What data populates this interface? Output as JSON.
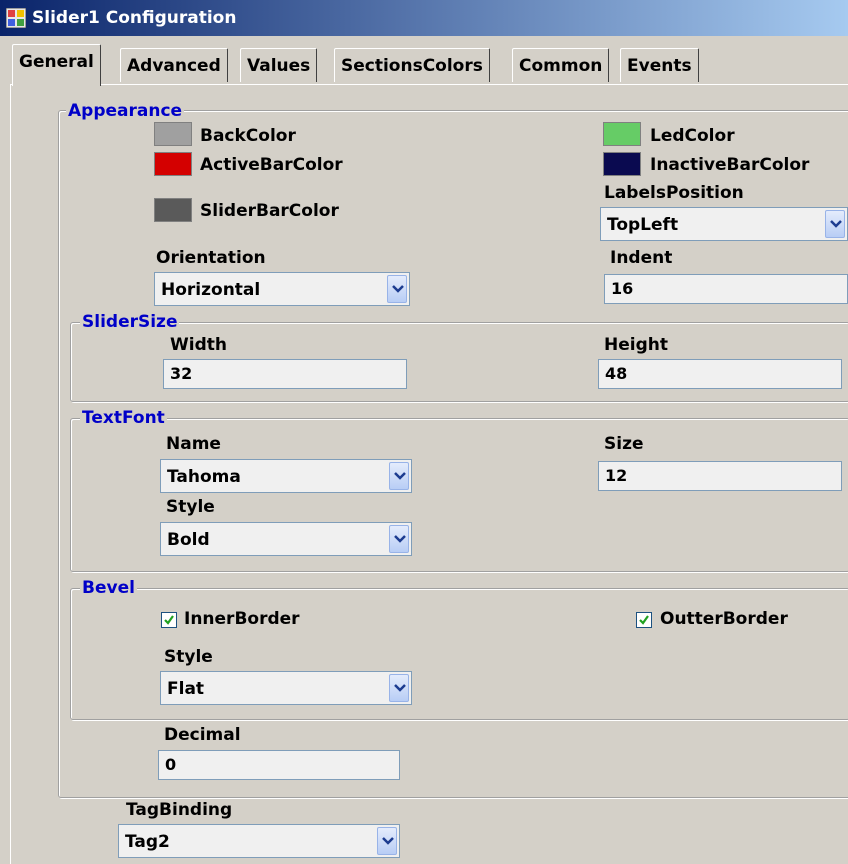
{
  "window": {
    "title": "Slider1 Configuration"
  },
  "tabs": [
    "General",
    "Advanced",
    "Values",
    "SectionsColors",
    "Common",
    "Events"
  ],
  "appearance": {
    "title": "Appearance",
    "back_color": {
      "label": "BackColor",
      "color": "#a0a0a0"
    },
    "active_bar_color": {
      "label": "ActiveBarColor",
      "color": "#d40000"
    },
    "slider_bar_color": {
      "label": "SliderBarColor",
      "color": "#5a5a5a"
    },
    "led_color": {
      "label": "LedColor",
      "color": "#66cc66"
    },
    "inactive_bar_color": {
      "label": "InactiveBarColor",
      "color": "#0a0a50"
    },
    "labels_position": {
      "label": "LabelsPosition",
      "value": "TopLeft"
    },
    "orientation": {
      "label": "Orientation",
      "value": "Horizontal"
    },
    "indent": {
      "label": "Indent",
      "value": "16"
    }
  },
  "slider_size": {
    "title": "SliderSize",
    "width": {
      "label": "Width",
      "value": "32"
    },
    "height": {
      "label": "Height",
      "value": "48"
    }
  },
  "text_font": {
    "title": "TextFont",
    "name": {
      "label": "Name",
      "value": "Tahoma"
    },
    "size": {
      "label": "Size",
      "value": "12"
    },
    "style": {
      "label": "Style",
      "value": "Bold"
    }
  },
  "bevel": {
    "title": "Bevel",
    "inner_border": {
      "label": "InnerBorder",
      "checked": true
    },
    "outter_border": {
      "label": "OutterBorder",
      "checked": true
    },
    "style": {
      "label": "Style",
      "value": "Flat"
    }
  },
  "decimal": {
    "label": "Decimal",
    "value": "0"
  },
  "tag_binding": {
    "label": "TagBinding",
    "value": "Tag2"
  }
}
